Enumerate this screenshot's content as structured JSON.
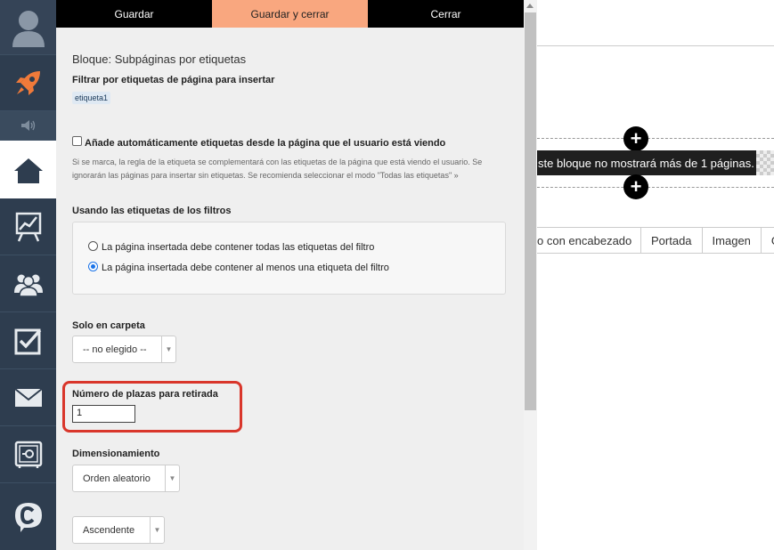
{
  "toolbar": {
    "save": "Guardar",
    "save_close": "Guardar y cerrar",
    "close": "Cerrar"
  },
  "panel": {
    "title": "Bloque: Subpáginas por etiquetas",
    "filter_label": "Filtrar por etiquetas de página para insertar",
    "tag": "etiqueta1",
    "auto_checkbox_label": "Añade automáticamente etiquetas desde la página que el usuario está viendo",
    "auto_checked": false,
    "hint_line1": "Si se marca, la regla de la etiqueta se complementará con las etiquetas de la página que está viendo el usuario. Se",
    "hint_line2": "ignorarán las páginas para insertar sin etiquetas. Se recomienda seleccionar el modo \"Todas las etiquetas\" »",
    "filters_label": "Usando las etiquetas de los filtros",
    "radio_all": "La página insertada debe contener todas las etiquetas del filtro",
    "radio_any": "La página insertada debe contener al menos una etiqueta del filtro",
    "folder_label": "Solo en carpeta",
    "folder_value": "-- no elegido --",
    "places_label": "Número de plazas para retirada",
    "places_value": "1",
    "sizing_label": "Dimensionamiento",
    "order_value": "Orden aleatorio",
    "direction_value": "Ascendente"
  },
  "preview": {
    "banner": "ste bloque no mostrará más de 1 páginas.",
    "tabs": [
      "o con encabezado",
      "Portada",
      "Imagen",
      "G"
    ]
  },
  "icons": {
    "rail": [
      "avatar-icon",
      "rocket-icon",
      "speaker-icon",
      "home-icon",
      "chart-icon",
      "people-icon",
      "checkbox-icon",
      "mail-icon",
      "safe-icon",
      "c-logo-icon"
    ],
    "plus": "plus-icon"
  },
  "colors": {
    "rail": "#2e3d4f",
    "accent": "#f9a77f",
    "highlight": "#d9362b",
    "rocket": "#f07a3a"
  }
}
